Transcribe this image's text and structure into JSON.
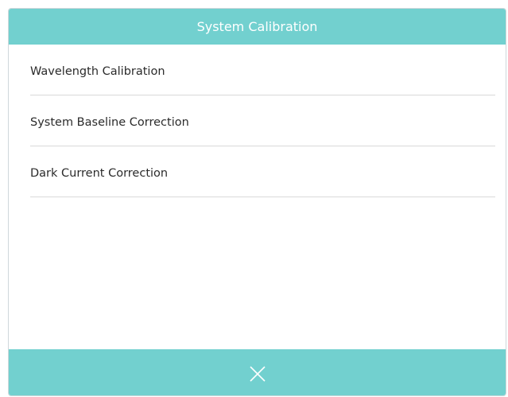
{
  "dialog": {
    "title": "System Calibration",
    "items": [
      {
        "label": "Wavelength Calibration"
      },
      {
        "label": "System Baseline Correction"
      },
      {
        "label": "Dark Current Correction"
      }
    ],
    "close_icon": "close-icon"
  },
  "colors": {
    "accent": "#72d0cf",
    "text": "#2b2b2b",
    "divider": "#d9d9d9"
  }
}
